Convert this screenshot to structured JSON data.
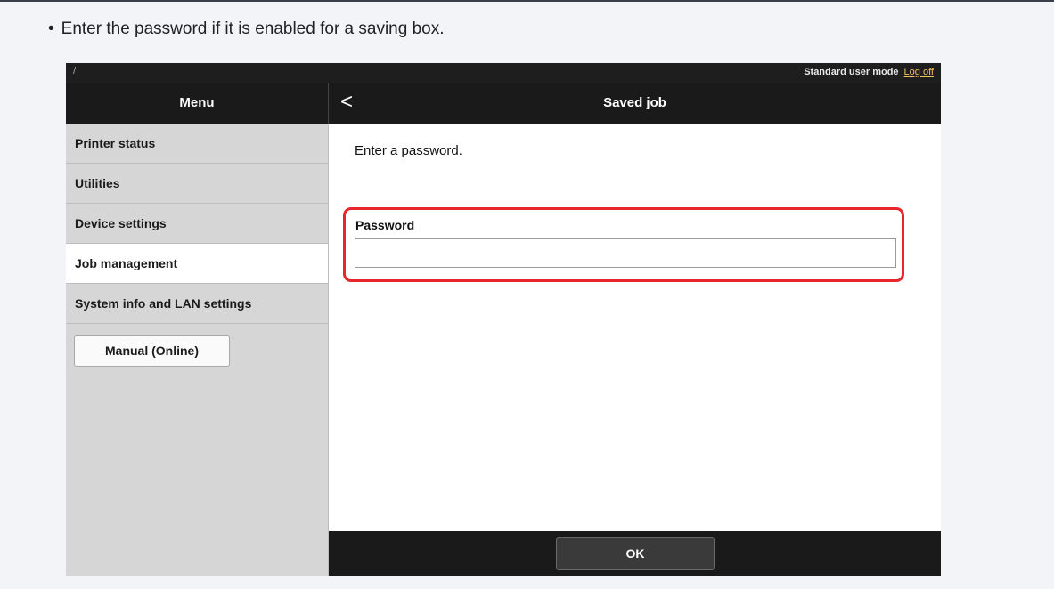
{
  "instruction": {
    "bullet": "•",
    "text": "Enter the password if it is enabled for a saving box."
  },
  "statusbar": {
    "tick": "/",
    "mode": "Standard user mode",
    "logoff": "Log off"
  },
  "header": {
    "menu_title": "Menu",
    "back_glyph": "<",
    "page_title": "Saved job"
  },
  "sidebar": {
    "items": [
      {
        "label": "Printer status"
      },
      {
        "label": "Utilities"
      },
      {
        "label": "Device settings"
      },
      {
        "label": "Job management",
        "active": true
      },
      {
        "label": "System info and LAN settings"
      }
    ],
    "manual_button": "Manual (Online)"
  },
  "main": {
    "prompt": "Enter a password.",
    "password_label": "Password",
    "password_value": ""
  },
  "footer": {
    "ok_label": "OK"
  },
  "colors": {
    "highlight": "#e8262d",
    "header": "#1a1a1a",
    "sidebar": "#d6d6d6"
  }
}
